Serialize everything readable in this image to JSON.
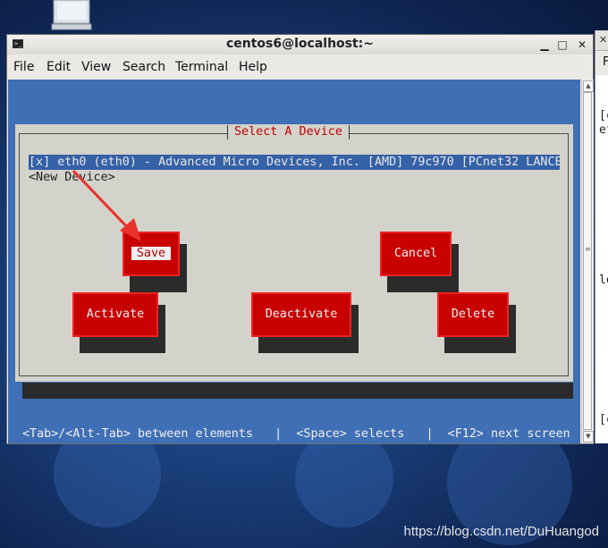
{
  "window": {
    "title": "centos6@localhost:~",
    "menu": [
      "File",
      "Edit",
      "View",
      "Search",
      "Terminal",
      "Help"
    ]
  },
  "second_window": {
    "menu_partial": "F",
    "term_lines_partial": [
      "[c",
      "et",
      "lo",
      "[c"
    ]
  },
  "dialog": {
    "title": "Select A Device",
    "devices": [
      {
        "label": "[x] eth0 (eth0) - Advanced Micro Devices, Inc. [AMD] 79c970 [PCnet32 LANCE",
        "selected": true
      },
      {
        "label": "<New Device>",
        "selected": false
      }
    ],
    "buttons": {
      "save": "Save",
      "cancel": "Cancel",
      "activate": "Activate",
      "deactivate": "Deactivate",
      "delete": "Delete"
    },
    "focused_button": "save"
  },
  "status_line": "<Tab>/<Alt-Tab> between elements   |  <Space> selects   |  <F12> next screen",
  "watermark": "https://blog.csdn.net/DuHuangod",
  "colors": {
    "desktop": "#1a3f7a",
    "terminal_bg": "#3f6fb5",
    "dialog_bg": "#d3d3cb",
    "button_red": "#c80000",
    "selection_blue": "#3561a6",
    "title_red": "#c00000",
    "annotation_arrow": "#e8322a"
  }
}
